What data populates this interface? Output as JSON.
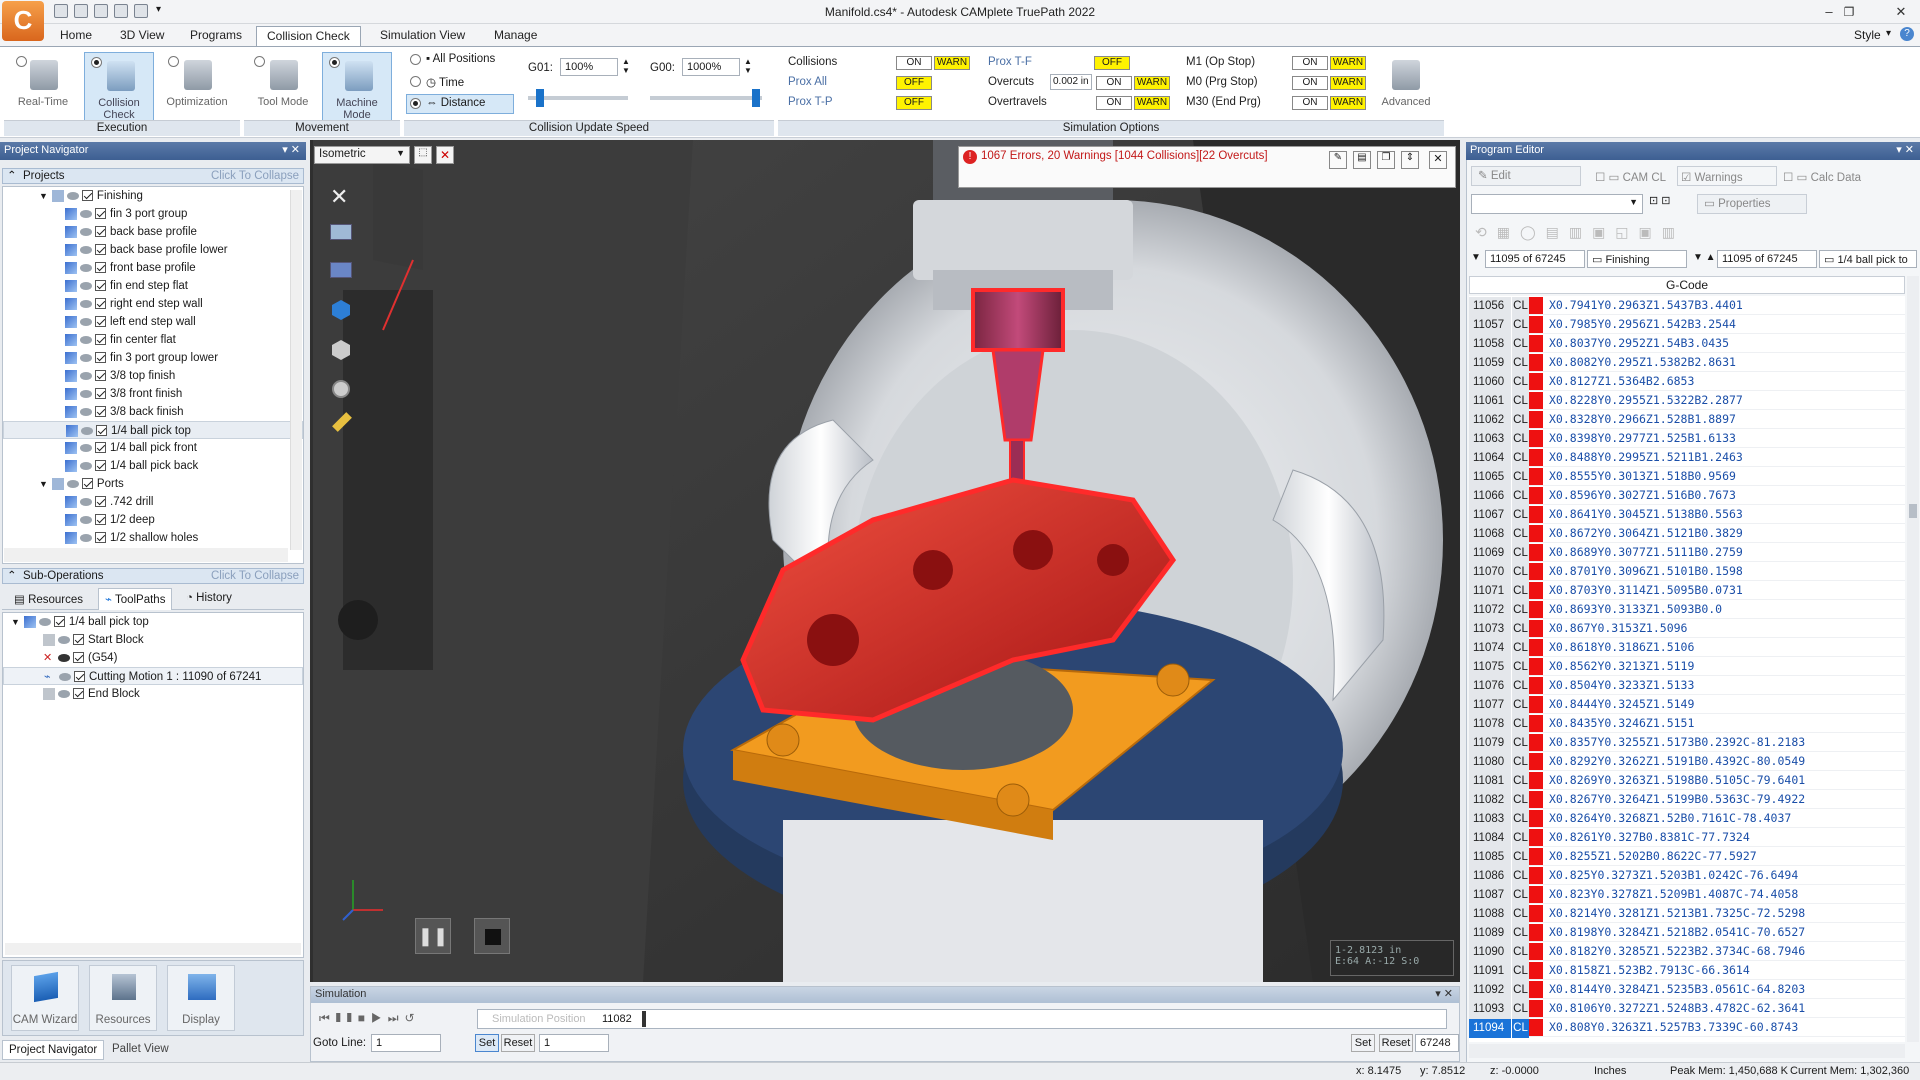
{
  "window": {
    "title": "Manifold.cs4* - Autodesk CAMplete TruePath 2022",
    "logo": "C",
    "min": "–",
    "restore": "❐",
    "close": "✕"
  },
  "menu": {
    "tabs": [
      "Home",
      "3D View",
      "Programs",
      "Collision Check",
      "Simulation View",
      "Manage"
    ],
    "active": "Collision Check",
    "style": "Style"
  },
  "ribbon": {
    "execution": {
      "caption": "Execution",
      "buttons": [
        "Real-Time",
        "Collision Check",
        "Optimization"
      ]
    },
    "movement": {
      "caption": "Movement",
      "buttons": [
        "Tool Mode",
        "Machine Mode"
      ]
    },
    "speed": {
      "caption": "Collision Update Speed",
      "options": [
        "All Positions",
        "Time",
        "Distance"
      ],
      "g01_label": "G01:",
      "g01_value": "100%",
      "g00_label": "G00:",
      "g00_value": "1000%"
    },
    "sim_options": {
      "caption": "Simulation Options",
      "on": "ON",
      "off": "OFF",
      "warn": "WARN",
      "collisions": "Collisions",
      "prox_all": "Prox All",
      "prox_tp": "Prox T-P",
      "prox_tf": "Prox T-F",
      "overcuts": "Overcuts",
      "overcut_value": "0.002 in",
      "overtravels": "Overtravels",
      "m1": "M1 (Op Stop)",
      "m0": "M0 (Prg Stop)",
      "m30": "M30 (End Prg)",
      "advanced": "Advanced"
    }
  },
  "navigator": {
    "title": "Project Navigator",
    "projects_label": "Projects",
    "collapse_hint": "Click To Collapse",
    "finishing": "Finishing",
    "ops": [
      "fin 3 port group",
      "back base profile",
      "back base profile lower",
      "front base profile",
      "fin end step flat",
      "right end step wall",
      "left end step wall",
      "fin center flat",
      "fin 3 port group lower",
      "3/8 top finish",
      "3/8 front finish",
      "3/8 back finish",
      "1/4 ball pick top",
      "1/4 ball pick front",
      "1/4 ball pick back"
    ],
    "ports": "Ports",
    "port_ops": [
      ".742 drill",
      "1/2 deep",
      "1/2 shallow holes"
    ],
    "subops_label": "Sub-Operations",
    "subtabs": [
      "Resources",
      "ToolPaths",
      "History"
    ],
    "toolpath_root": "1/4 ball pick top",
    "toolpath_items": [
      "Start Block",
      "(G54)",
      "Cutting Motion 1 : 11090 of 67241",
      "End Block"
    ],
    "bottom_buttons": [
      "CAM Wizard",
      "Resources",
      "Display"
    ],
    "bottom_tabs": [
      "Project Navigator",
      "Pallet View"
    ]
  },
  "viewport": {
    "view_select": "Isometric",
    "error_banner": "1067 Errors, 20 Warnings [1044 Collisions][22 Overcuts]",
    "coord_line1": "1-2.8123 in",
    "coord_line2": "E:64 A:-12 S:0"
  },
  "simulation": {
    "title": "Simulation",
    "position_label": "Simulation Position",
    "position_value": "11082",
    "goto_label": "Goto Line:",
    "goto_value": "1",
    "set": "Set",
    "reset": "Reset",
    "start_value": "1",
    "end_value": "67248"
  },
  "program_editor": {
    "title": "Program Editor",
    "edit": "Edit",
    "cam_cl": "CAM CL",
    "warnings": "Warnings",
    "calc_data": "Calc Data",
    "properties": "Properties",
    "counter_left": "11095 of 67245",
    "program_name": "Finishing",
    "counter_right": "11095 of 67245",
    "op_name": "1/4 ball pick to",
    "column": "G-Code",
    "cl": "CL",
    "rows": [
      [
        "11056",
        "X0.7941Y0.2963Z1.5437B3.4401"
      ],
      [
        "11057",
        "X0.7985Y0.2956Z1.542B3.2544"
      ],
      [
        "11058",
        "X0.8037Y0.2952Z1.54B3.0435"
      ],
      [
        "11059",
        "X0.8082Y0.295Z1.5382B2.8631"
      ],
      [
        "11060",
        "X0.8127Z1.5364B2.6853"
      ],
      [
        "11061",
        "X0.8228Y0.2955Z1.5322B2.2877"
      ],
      [
        "11062",
        "X0.8328Y0.2966Z1.528B1.8897"
      ],
      [
        "11063",
        "X0.8398Y0.2977Z1.525B1.6133"
      ],
      [
        "11064",
        "X0.8488Y0.2995Z1.5211B1.2463"
      ],
      [
        "11065",
        "X0.8555Y0.3013Z1.518B0.9569"
      ],
      [
        "11066",
        "X0.8596Y0.3027Z1.516B0.7673"
      ],
      [
        "11067",
        "X0.8641Y0.3045Z1.5138B0.5563"
      ],
      [
        "11068",
        "X0.8672Y0.3064Z1.5121B0.3829"
      ],
      [
        "11069",
        "X0.8689Y0.3077Z1.5111B0.2759"
      ],
      [
        "11070",
        "X0.8701Y0.3096Z1.5101B0.1598"
      ],
      [
        "11071",
        "X0.8703Y0.3114Z1.5095B0.0731"
      ],
      [
        "11072",
        "X0.8693Y0.3133Z1.5093B0.0"
      ],
      [
        "11073",
        "X0.867Y0.3153Z1.5096"
      ],
      [
        "11074",
        "X0.8618Y0.3186Z1.5106"
      ],
      [
        "11075",
        "X0.8562Y0.3213Z1.5119"
      ],
      [
        "11076",
        "X0.8504Y0.3233Z1.5133"
      ],
      [
        "11077",
        "X0.8444Y0.3245Z1.5149"
      ],
      [
        "11078",
        "X0.8435Y0.3246Z1.5151"
      ],
      [
        "11079",
        "X0.8357Y0.3255Z1.5173B0.2392C-81.2183"
      ],
      [
        "11080",
        "X0.8292Y0.3262Z1.5191B0.4392C-80.0549"
      ],
      [
        "11081",
        "X0.8269Y0.3263Z1.5198B0.5105C-79.6401"
      ],
      [
        "11082",
        "X0.8267Y0.3264Z1.5199B0.5363C-79.4922"
      ],
      [
        "11083",
        "X0.8264Y0.3268Z1.52B0.7161C-78.4037"
      ],
      [
        "11084",
        "X0.8261Y0.327B0.8381C-77.7324"
      ],
      [
        "11085",
        "X0.8255Z1.5202B0.8622C-77.5927"
      ],
      [
        "11086",
        "X0.825Y0.3273Z1.5203B1.0242C-76.6494"
      ],
      [
        "11087",
        "X0.823Y0.3278Z1.5209B1.4087C-74.4058"
      ],
      [
        "11088",
        "X0.8214Y0.3281Z1.5213B1.7325C-72.5298"
      ],
      [
        "11089",
        "X0.8198Y0.3284Z1.5218B2.0541C-70.6527"
      ],
      [
        "11090",
        "X0.8182Y0.3285Z1.5223B2.3734C-68.7946"
      ],
      [
        "11091",
        "X0.8158Z1.523B2.7913C-66.3614"
      ],
      [
        "11092",
        "X0.8144Y0.3284Z1.5235B3.0561C-64.8203"
      ],
      [
        "11093",
        "X0.8106Y0.3272Z1.5248B3.4782C-62.3641"
      ],
      [
        "11094",
        "X0.808Y0.3263Z1.5257B3.7339C-60.8743"
      ]
    ],
    "active_row": "11094"
  },
  "status": {
    "x": "x: 8.1475",
    "y": "y: 7.8512",
    "z": "z: -0.0000",
    "units": "Inches",
    "peak": "Peak Mem: 1,450,688 K",
    "current": "Current Mem: 1,302,360"
  },
  "colors": {
    "accent": "#1a73d8",
    "panel_header": "#3d5f92",
    "collision": "#d81e1e",
    "warn_yellow": "#fff200",
    "fixture_orange": "#f29b1f"
  }
}
